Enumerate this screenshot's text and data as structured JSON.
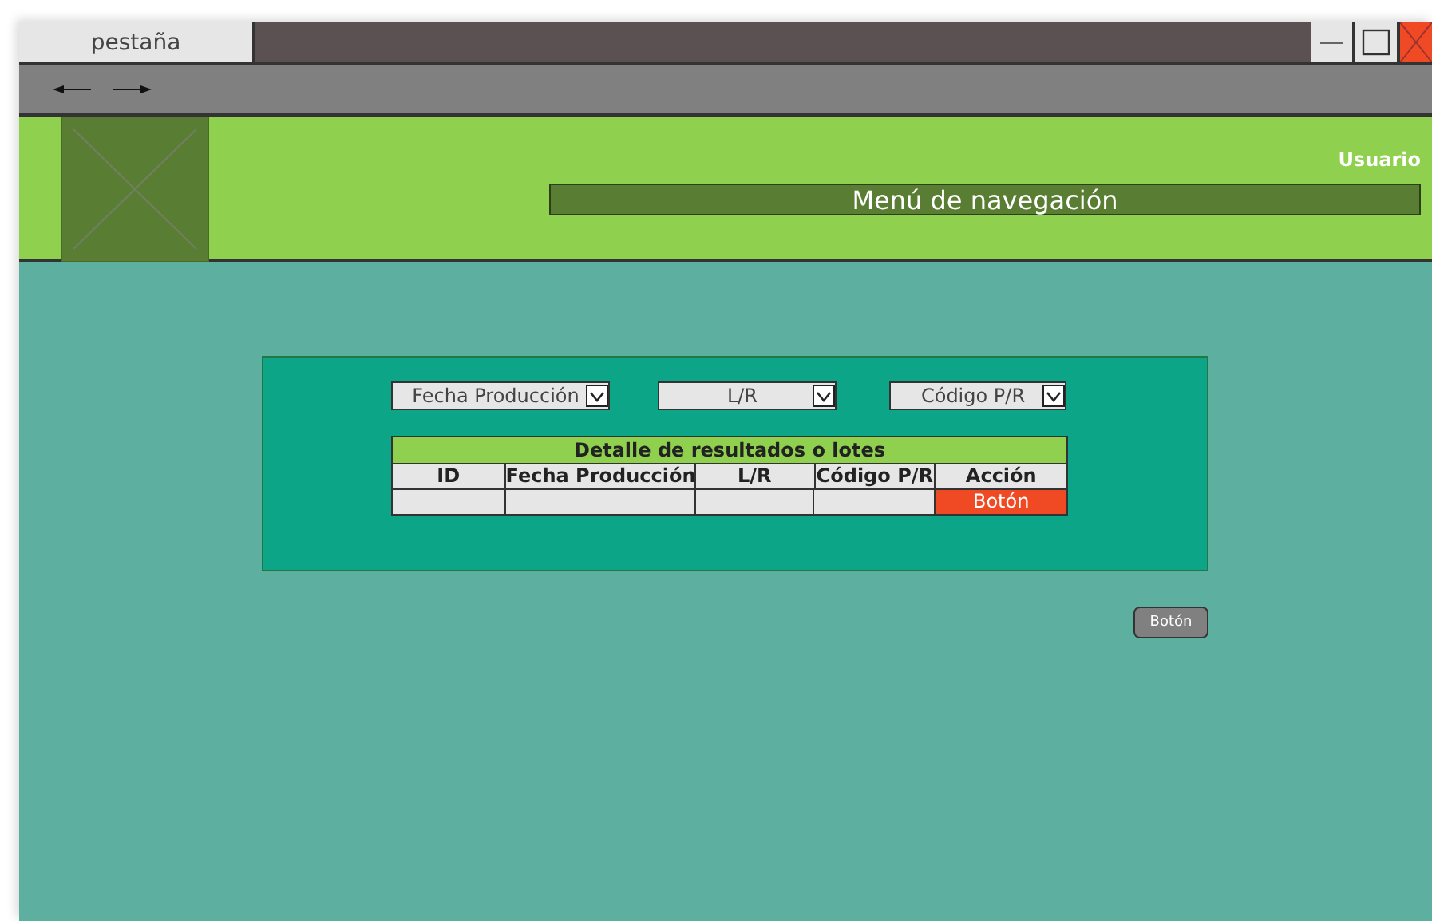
{
  "window": {
    "tab": "pestaña"
  },
  "header": {
    "user": "Usuario",
    "nav": "Menú de navegación"
  },
  "filters": [
    {
      "label": "Fecha Producción"
    },
    {
      "label": "L/R"
    },
    {
      "label": "Código P/R"
    }
  ],
  "table": {
    "title": "Detalle de resultados o lotes",
    "columns": [
      "ID",
      "Fecha Producción",
      "L/R",
      "Código P/R",
      "Acción"
    ],
    "rows": [
      {
        "cells": [
          "",
          "",
          "",
          ""
        ],
        "action": "Botón"
      }
    ]
  },
  "button": "Botón"
}
